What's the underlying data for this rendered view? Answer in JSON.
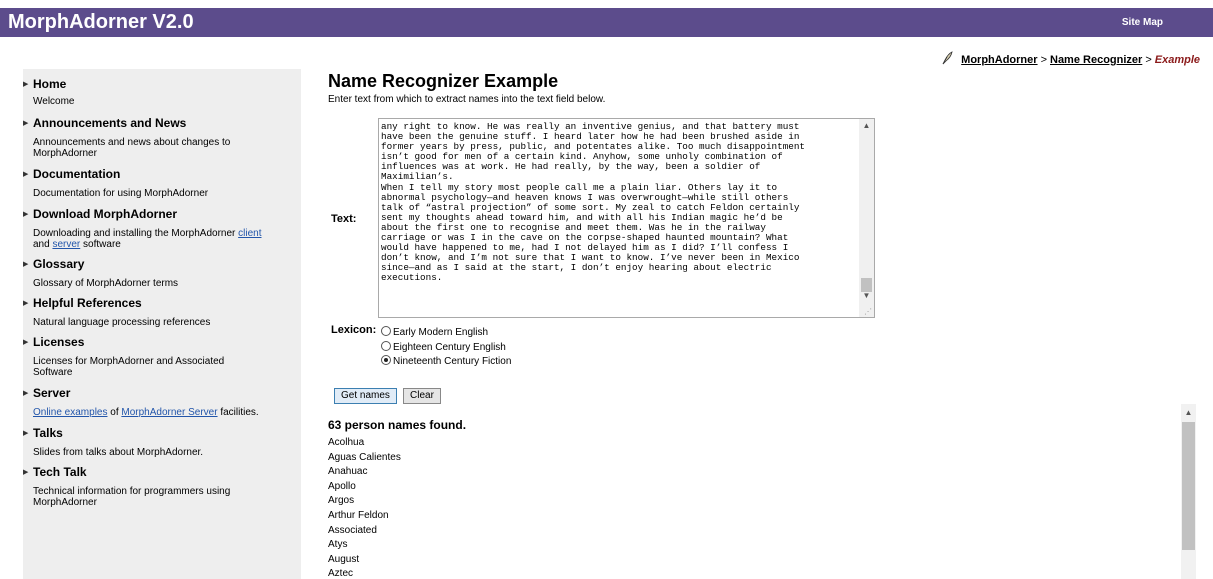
{
  "header": {
    "app_title": "MorphAdorner V2.0",
    "site_map": "Site Map"
  },
  "breadcrumb": {
    "icon": "quill-icon",
    "items": [
      "MorphAdorner",
      "Name Recognizer"
    ],
    "separator": ">",
    "current": "Example"
  },
  "sidebar": {
    "items": [
      {
        "label": "Home",
        "desc": "Welcome"
      },
      {
        "label": "Announcements and News",
        "desc": "Announcements and news about changes to MorphAdorner"
      },
      {
        "label": "Documentation",
        "desc": "Documentation for using MorphAdorner"
      },
      {
        "label": "Download MorphAdorner",
        "desc_pre": "Downloading and installing the MorphAdorner ",
        "link1": "client",
        "desc_mid": " and ",
        "link2": "server",
        "desc_post": " software"
      },
      {
        "label": "Glossary",
        "desc": "Glossary of MorphAdorner terms"
      },
      {
        "label": "Helpful References",
        "desc": "Natural language processing references"
      },
      {
        "label": "Licenses",
        "desc": "Licenses for MorphAdorner and Associated Software"
      },
      {
        "label": "Server",
        "link1": "Online examples",
        "desc_mid": " of ",
        "link2": "MorphAdorner Server",
        "desc_post": " facilities."
      },
      {
        "label": "Talks",
        "desc": "Slides from talks about MorphAdorner."
      },
      {
        "label": "Tech Talk",
        "desc": "Technical information for programmers using MorphAdorner"
      }
    ]
  },
  "main": {
    "title": "Name Recognizer Example",
    "instructions": "Enter text from which to extract names into the text field below.",
    "text_label": "Text:",
    "text_value": "any right to know. He was really an inventive genius, and that battery must\nhave been the genuine stuff. I heard later how he had been brushed aside in\nformer years by press, public, and potentates alike. Too much disappointment\nisn’t good for men of a certain kind. Anyhow, some unholy combination of\ninfluences was at work. He had really, by the way, been a soldier of\nMaximilian’s.\nWhen I tell my story most people call me a plain liar. Others lay it to\nabnormal psychology—and heaven knows I was overwrought—while still others\ntalk of “astral projection” of some sort. My zeal to catch Feldon certainly\nsent my thoughts ahead toward him, and with all his Indian magic he’d be\nabout the first one to recognise and meet them. Was he in the railway\ncarriage or was I in the cave on the corpse-shaped haunted mountain? What\nwould have happened to me, had I not delayed him as I did? I’ll confess I\ndon’t know, and I’m not sure that I want to know. I’ve never been in Mexico\nsince—and as I said at the start, I don’t enjoy hearing about electric\nexecutions.",
    "lexicon_label": "Lexicon:",
    "lexicon_options": [
      "Early Modern English",
      "Eighteen Century English",
      "Nineteenth Century Fiction"
    ],
    "lexicon_selected": "Nineteenth Century Fiction",
    "get_names_button": "Get names",
    "clear_button": "Clear",
    "results_title": "63 person names found.",
    "names": [
      "Acolhua",
      "Aguas Calientes",
      "Anahuac",
      "Apollo",
      "Argos",
      "Arthur Feldon",
      "Associated",
      "Atys",
      "August",
      "Aztec"
    ]
  }
}
